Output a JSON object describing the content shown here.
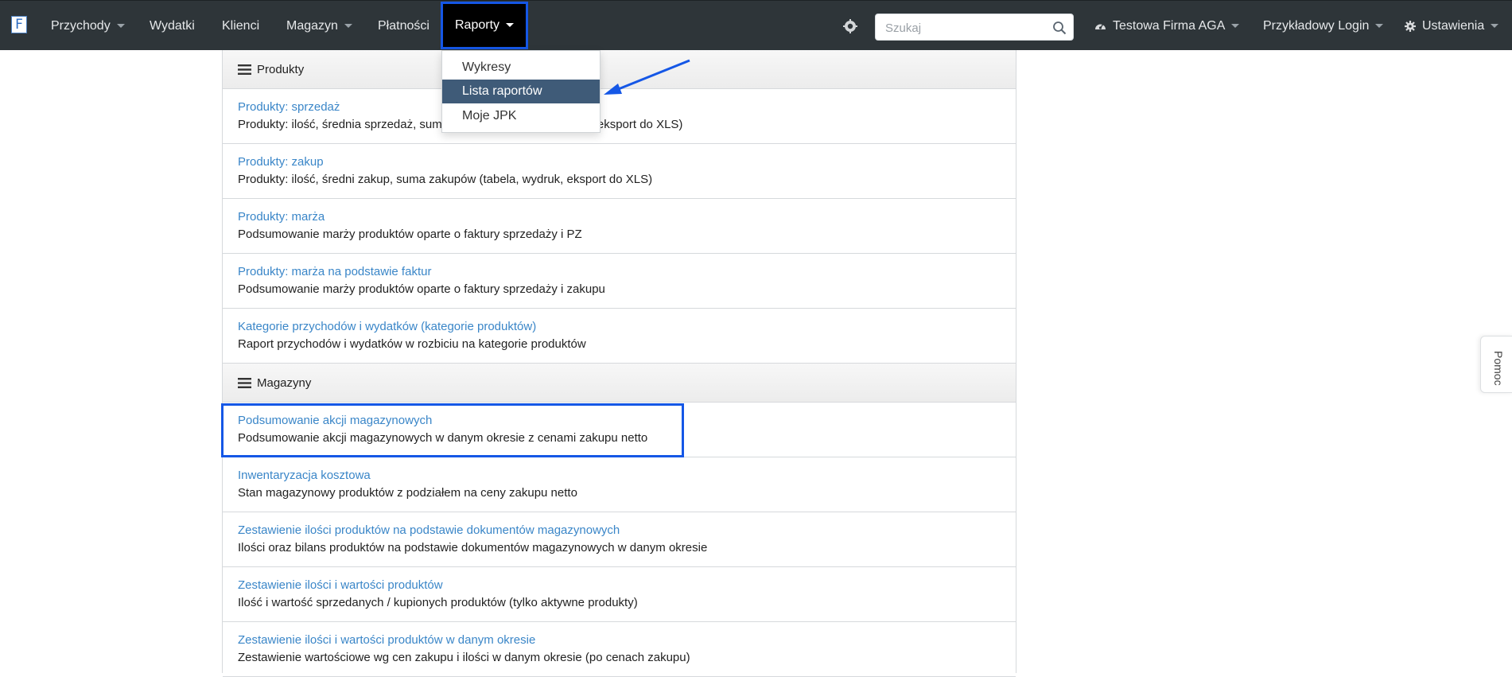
{
  "navbar": {
    "logo_letter": "F",
    "items": [
      {
        "label": "Przychody",
        "has_caret": true
      },
      {
        "label": "Wydatki",
        "has_caret": false
      },
      {
        "label": "Klienci",
        "has_caret": false
      },
      {
        "label": "Magazyn",
        "has_caret": true
      },
      {
        "label": "Płatności",
        "has_caret": false
      }
    ],
    "active_item": "Raporty",
    "search_placeholder": "Szukaj",
    "company": "Testowa Firma AGA",
    "login": "Przykładowy Login",
    "settings": "Ustawienia"
  },
  "dropdown": {
    "items": [
      "Wykresy",
      "Lista raportów",
      "Moje JPK"
    ],
    "active_index": 1
  },
  "sections": [
    {
      "title": "Produkty",
      "reports": [
        {
          "link": "Produkty: sprzedaż",
          "desc": "Produkty: ilość, średnia sprzedaż, suma sprzedaży (tabela, wydruk, eksport do XLS)"
        },
        {
          "link": "Produkty: zakup",
          "desc": "Produkty: ilość, średni zakup, suma zakupów (tabela, wydruk, eksport do XLS)"
        },
        {
          "link": "Produkty: marża",
          "desc": "Podsumowanie marży produktów oparte o faktury sprzedaży i PZ"
        },
        {
          "link": "Produkty: marża na podstawie faktur",
          "desc": "Podsumowanie marży produktów oparte o faktury sprzedaży i zakupu"
        },
        {
          "link": "Kategorie przychodów i wydatków (kategorie produktów)",
          "desc": "Raport przychodów i wydatków w rozbiciu na kategorie produktów"
        }
      ]
    },
    {
      "title": "Magazyny",
      "reports": [
        {
          "link": "Podsumowanie akcji magazynowych",
          "desc": "Podsumowanie akcji magazynowych w danym okresie z cenami zakupu netto"
        },
        {
          "link": "Inwentaryzacja kosztowa",
          "desc": "Stan magazynowy produktów z podziałem na ceny zakupu netto"
        },
        {
          "link": "Zestawienie ilości produktów na podstawie dokumentów magazynowych",
          "desc": "Ilości oraz bilans produktów na podstawie dokumentów magazynowych w danym okresie"
        },
        {
          "link": "Zestawienie ilości i wartości produktów",
          "desc": "Ilość i wartość sprzedanych / kupionych produktów (tylko aktywne produkty)"
        },
        {
          "link": "Zestawienie ilości i wartości produktów w danym okresie",
          "desc": "Zestawienie wartościowe wg cen zakupu i ilości w danym okresie (po cenach zakupu)"
        }
      ]
    }
  ],
  "help_tab": "Pomoc",
  "colors": {
    "navbar_bg": "#2e3539",
    "highlight_border": "#1557e6",
    "link": "#3a86c8",
    "dropdown_active_bg": "#3f5b78"
  }
}
